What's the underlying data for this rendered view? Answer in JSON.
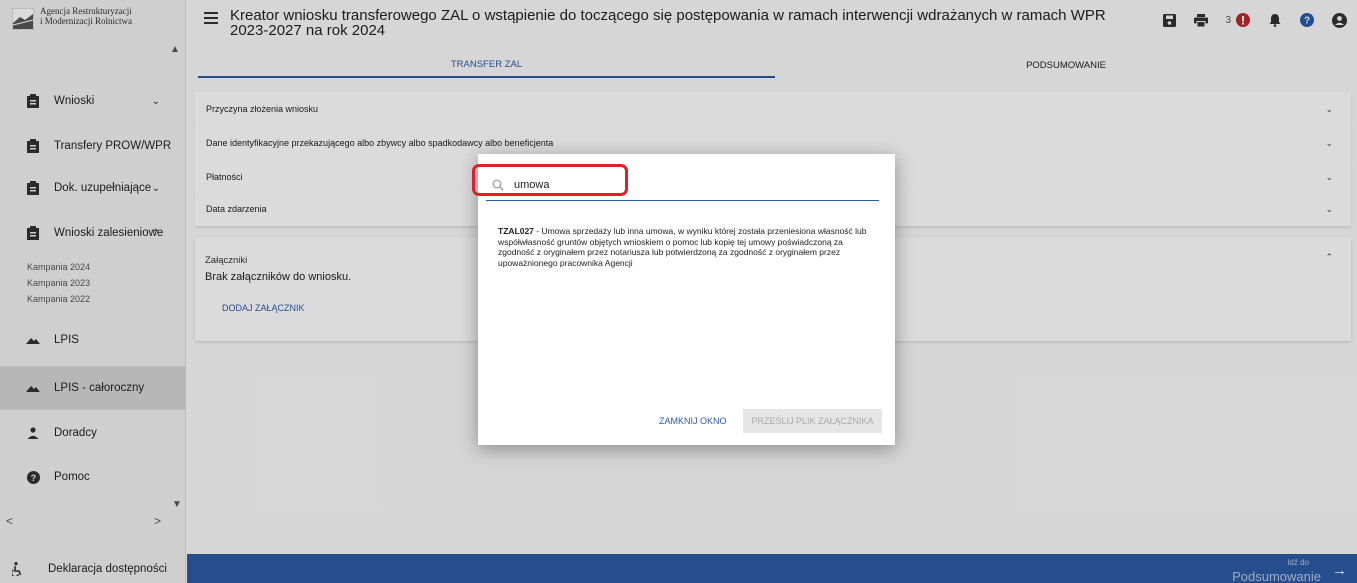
{
  "sidebar": {
    "logo": {
      "line1": "Agencja Restrukturyzacji",
      "line2": "i Modernizacji Rolnictwa"
    },
    "items": [
      {
        "label": "Wnioski",
        "icon": "clipboard-icon",
        "has_chevron": true
      },
      {
        "label": "Transfery PROW/WPR",
        "icon": "clipboard-icon"
      },
      {
        "label": "Dok. uzupełniające",
        "icon": "clipboard-icon",
        "has_chevron": true
      },
      {
        "label": "Wnioski zalesieniowe",
        "icon": "clipboard-icon",
        "has_chevron": true
      },
      {
        "label": "LPIS",
        "icon": "mountain-icon"
      },
      {
        "label": "LPIS - całoroczny",
        "icon": "mountain-icon",
        "active": true
      },
      {
        "label": "Doradcy",
        "icon": "person-icon"
      },
      {
        "label": "Pomoc",
        "icon": "help-icon"
      }
    ],
    "sub_items": [
      "Kampania 2024",
      "Kampania 2023",
      "Kampania 2022"
    ],
    "accessibility": "Deklaracja dostępności"
  },
  "header": {
    "title_line1": "Kreator wniosku transferowego ZAL o wstąpienie do toczącego się postępowania w ramach interwencji wdrażanych w ramach WPR",
    "title_line2": "2023-2027 na rok 2024",
    "notification_count": "3",
    "icons": [
      "save-icon",
      "print-icon",
      "alert-icon",
      "bell-icon",
      "help-icon",
      "account-icon"
    ]
  },
  "tabs": [
    {
      "label": "TRANSFER ZAL",
      "active": true
    },
    {
      "label": "PODSUMOWANIE",
      "active": false
    }
  ],
  "accordion": [
    "Przyczyna złożenia wniosku",
    "Dane identyfikacyjne przekazującego albo zbywcy albo spadkodawcy albo beneficjenta",
    "Płatności",
    "Data zdarzenia"
  ],
  "attachments": {
    "label": "Załączniki",
    "empty_text": "Brak załączników do wniosku.",
    "add_button": "DODAJ ZAŁĄCZNIK"
  },
  "bottom": {
    "small": "Idź do",
    "big": "Podsumowanie"
  },
  "modal": {
    "search_value": "umowa",
    "result_code": "TZAL027",
    "result_text": " - Umowa sprzedaży lub inna umowa, w wyniku której została przeniesiona własność lub współwłasność gruntów objętych wnioskiem o pomoc lub kopię tej umowy poświadczoną za zgodność z oryginałem przez notariusza lub potwierdzoną za zgodność z oryginałem przez upoważnionego pracownika Agencji",
    "close_button": "ZAMKNIJ OKNO",
    "send_button": "PRZEŚLIJ PLIK ZAŁĄCZNIKA"
  },
  "colors": {
    "accent": "#2b5aa8",
    "highlight": "#e41e26",
    "bottom_bar": "#2d5aa5"
  }
}
